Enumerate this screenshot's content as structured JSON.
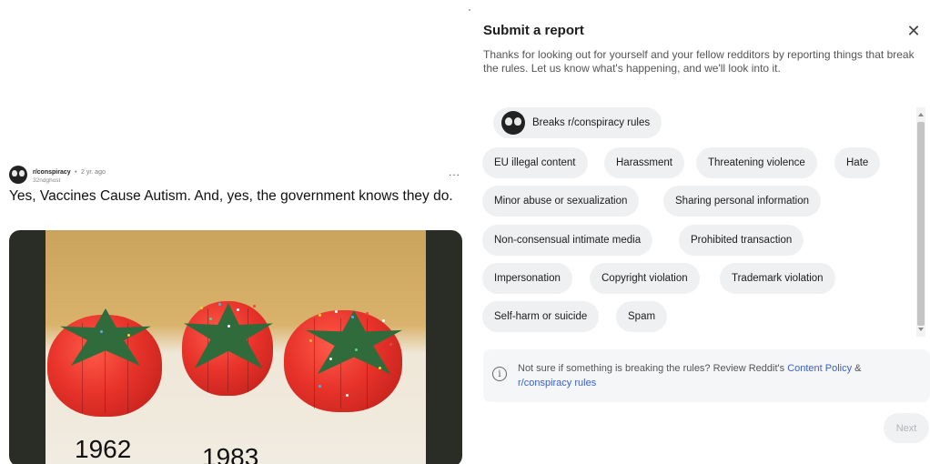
{
  "post": {
    "subreddit": "r/conspiracy",
    "separator": "•",
    "age": "2 yr. ago",
    "username": "32ndghost",
    "more": "...",
    "title": "Yes, Vaccines Cause Autism. And, yes, the government knows they do.",
    "image_years": [
      "1962",
      "1983"
    ]
  },
  "report": {
    "title": "Submit a report",
    "close_icon": "close-icon",
    "description": "Thanks for looking out for yourself and your fellow redditors by reporting things that break the rules. Let us know what's happening, and we'll look into it.",
    "options": [
      {
        "label": "Breaks r/conspiracy rules"
      },
      {
        "label": "EU illegal content"
      },
      {
        "label": "Harassment"
      },
      {
        "label": "Threatening violence"
      },
      {
        "label": "Hate"
      },
      {
        "label": "Minor abuse or sexualization"
      },
      {
        "label": "Sharing personal information"
      },
      {
        "label": "Non-consensual intimate media"
      },
      {
        "label": "Prohibited transaction"
      },
      {
        "label": "Impersonation"
      },
      {
        "label": "Copyright violation"
      },
      {
        "label": "Trademark violation"
      },
      {
        "label": "Self-harm or suicide"
      },
      {
        "label": "Spam"
      }
    ],
    "info": {
      "icon": "info-icon",
      "text_before": "Not sure if something is breaking the rules? Review Reddit's ",
      "link_policy": "Content Policy",
      "text_mid": " & ",
      "link_rules": "r/conspiracy rules"
    },
    "next_label": "Next"
  }
}
